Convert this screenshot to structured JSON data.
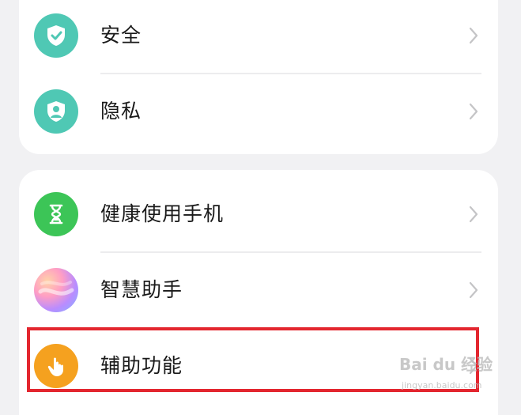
{
  "sections": [
    {
      "items": [
        {
          "label": "安全",
          "icon": "shield-check-icon",
          "color": "#4fc8b4"
        },
        {
          "label": "隐私",
          "icon": "privacy-shield-icon",
          "color": "#4fc8b4"
        }
      ]
    },
    {
      "items": [
        {
          "label": "健康使用手机",
          "icon": "hourglass-icon",
          "color": "#3cc557"
        },
        {
          "label": "智慧助手",
          "icon": "assistant-orb-icon",
          "color": "#c7a8ff"
        },
        {
          "label": "辅助功能",
          "icon": "hand-pointer-icon",
          "color": "#f5a11f"
        }
      ]
    }
  ],
  "highlight_color": "#e3262f",
  "watermark": {
    "text": "Bai du 经验",
    "subtext": "jingyan.baidu.com"
  }
}
